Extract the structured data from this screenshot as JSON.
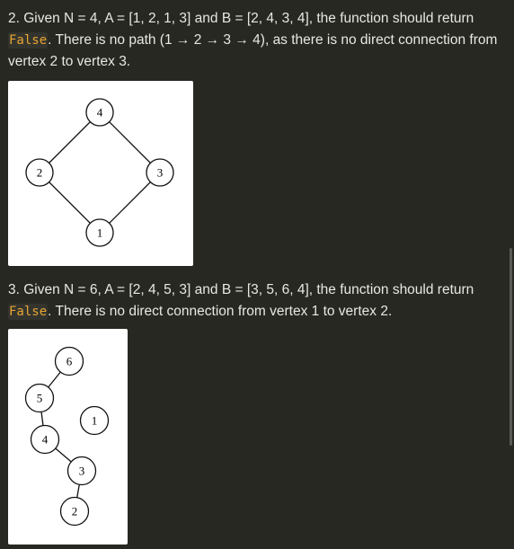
{
  "example2": {
    "text_before": "2. Given N = 4, A = [1, 2, 1, 3] and B = [2, 4, 3, 4], the function should return ",
    "code": "False",
    "text_after": ". There is no path (1 → 2 → 3 → 4), as there is no direct connection from vertex 2 to vertex 3.",
    "graph": {
      "nodes": [
        "4",
        "2",
        "3",
        "1"
      ],
      "edges": [
        [
          "4",
          "2"
        ],
        [
          "4",
          "3"
        ],
        [
          "2",
          "1"
        ],
        [
          "3",
          "1"
        ]
      ]
    }
  },
  "example3": {
    "text_before": "3. Given N = 6, A = [2, 4, 5, 3] and B = [3, 5, 6, 4], the function should return ",
    "code": "False",
    "text_after": ". There is no direct connection from vertex 1 to vertex 2.",
    "graph": {
      "nodes": [
        "6",
        "5",
        "1",
        "4",
        "3",
        "2"
      ],
      "edges": [
        [
          "6",
          "5"
        ],
        [
          "5",
          "4"
        ],
        [
          "4",
          "3"
        ],
        [
          "3",
          "2"
        ]
      ]
    }
  },
  "colors": {
    "background": "#272822",
    "code": "#e6a532",
    "text": "#e8e8e2"
  }
}
